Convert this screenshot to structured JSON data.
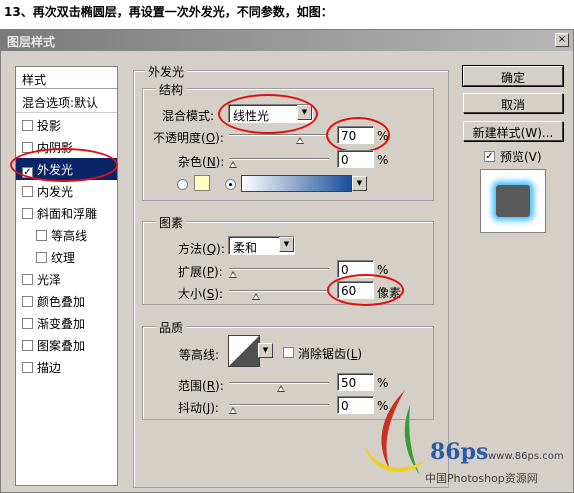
{
  "caption": "13、再次双击椭圆层，再设置一次外发光，不同参数，如图：",
  "dialog": {
    "title": "图层样式",
    "close_glyph": "×"
  },
  "sidebar": {
    "header": "样式",
    "blend_options": "混合选项:默认",
    "items": [
      {
        "label": "投影",
        "checked": false
      },
      {
        "label": "内阴影",
        "checked": false
      },
      {
        "label": "外发光",
        "checked": true
      },
      {
        "label": "内发光",
        "checked": false
      },
      {
        "label": "斜面和浮雕",
        "checked": false
      },
      {
        "label": "等高线",
        "checked": false
      },
      {
        "label": "纹理",
        "checked": false
      },
      {
        "label": "光泽",
        "checked": false
      },
      {
        "label": "颜色叠加",
        "checked": false
      },
      {
        "label": "渐变叠加",
        "checked": false
      },
      {
        "label": "图案叠加",
        "checked": false
      },
      {
        "label": "描边",
        "checked": false
      }
    ]
  },
  "outer_glow": {
    "title": "外发光",
    "structure": {
      "title": "结构",
      "blend_mode_label": "混合模式:",
      "blend_mode_value": "线性光",
      "opacity_label": "不透明度(",
      "opacity_key": "O",
      "opacity_value": "70",
      "opacity_unit": "%",
      "opacity_level": 0.7,
      "noise_label": "杂色(",
      "noise_key": "N",
      "noise_value": "0",
      "noise_unit": "%",
      "noise_level": 0,
      "swatch_color": "#ffffc0",
      "gradient_start": "#ffffff",
      "gradient_end": "#1a4f9c"
    },
    "elements": {
      "title": "图素",
      "method_label": "方法(",
      "method_key": "Q",
      "method_value": "柔和",
      "spread_label": "扩展(",
      "spread_key": "P",
      "spread_value": "0",
      "spread_unit": "%",
      "spread_level": 0,
      "size_label": "大小(",
      "size_key": "S",
      "size_value": "60",
      "size_unit": "像素",
      "size_level": 0.24
    },
    "quality": {
      "title": "品质",
      "contour_label": "等高线:",
      "antialias_label": "消除锯齿(",
      "antialias_key": "L",
      "antialias_checked": false,
      "range_label": "范围(",
      "range_key": "R",
      "range_value": "50",
      "range_unit": "%",
      "range_level": 0.5,
      "jitter_label": "抖动(",
      "jitter_key": "J",
      "jitter_value": "0",
      "jitter_unit": "%",
      "jitter_level": 0
    }
  },
  "buttons": {
    "ok": "确定",
    "cancel": "取消",
    "new_style": "新建样式(W)...",
    "preview_label": "预览(V)",
    "preview_checked": true
  },
  "watermark": {
    "logo_text": "86ps",
    "url": "www.86ps.com",
    "site": "中国Photoshop资源网"
  },
  "colors": {
    "highlight": "#0a246a",
    "annotation_red": "#e01010",
    "glow": "#4fc3ff"
  }
}
